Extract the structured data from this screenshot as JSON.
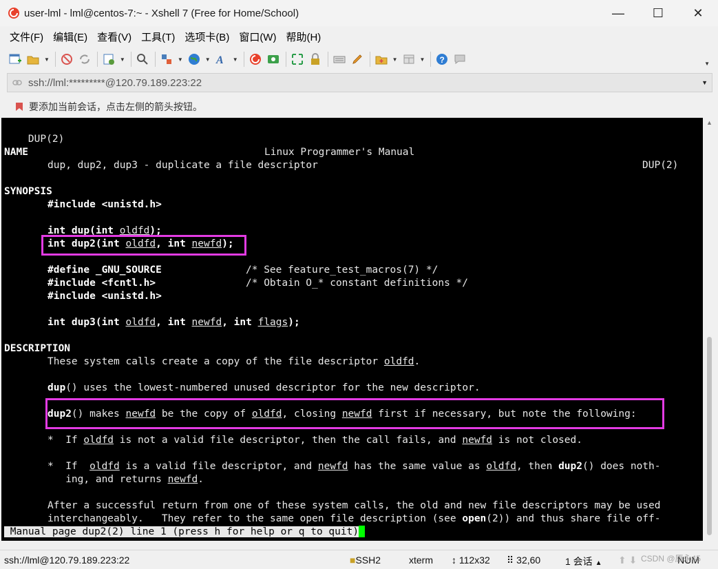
{
  "window": {
    "title": "user-lml - lml@centos-7:~ - Xshell 7 (Free for Home/School)",
    "minimize": "—",
    "maximize": "☐",
    "close": "✕"
  },
  "menu": [
    "文件(F)",
    "编辑(E)",
    "查看(V)",
    "工具(T)",
    "选项卡(B)",
    "窗口(W)",
    "帮助(H)"
  ],
  "address": {
    "value": "ssh://lml:*********@120.79.189.223:22"
  },
  "hint": {
    "text": "要添加当前会话，点击左侧的箭头按钮。"
  },
  "terminal": {
    "header_left": "DUP(2)",
    "header_center": "Linux Programmer's Manual",
    "header_right": "DUP(2)",
    "name_heading": "NAME",
    "name_desc": "dup, dup2, dup3 - duplicate a file descriptor",
    "synopsis_heading": "SYNOPSIS",
    "include_unistd": "#include <unistd.h>",
    "dup_sig": {
      "pre": "int dup(int ",
      "arg": "oldfd",
      "post": ");"
    },
    "dup2_sig": {
      "pre": "int dup2(int ",
      "arg1": "oldfd",
      "mid": ", int ",
      "arg2": "newfd",
      "post": ");"
    },
    "define_gnu": "#define _GNU_SOURCE",
    "define_gnu_comment": "/* See feature_test_macros(7) */",
    "include_fcntl": "#include <fcntl.h>",
    "include_fcntl_comment": "/* Obtain O_* constant definitions */",
    "include_unistd2": "#include <unistd.h>",
    "dup3_sig": {
      "pre": "int dup3(int ",
      "arg1": "oldfd",
      "mid1": ", int ",
      "arg2": "newfd",
      "mid2": ", int ",
      "arg3": "flags",
      "post": ");"
    },
    "description_heading": "DESCRIPTION",
    "desc1": {
      "pre": "These system calls create a copy of the file descriptor ",
      "arg": "oldfd",
      "post": "."
    },
    "desc2": {
      "bold": "dup",
      "post": "() uses the lowest-numbered unused descriptor for the new descriptor."
    },
    "desc3": {
      "bold": "dup2",
      "a": "() makes ",
      "u1": "newfd",
      "b": " be the copy of ",
      "u2": "oldfd",
      "c": ", closing ",
      "u3": "newfd",
      "d": " first if necessary, but note the following:"
    },
    "bullet1": {
      "a": "*  If ",
      "u1": "oldfd",
      "b": " is not a valid file descriptor, then the call fails, and ",
      "u2": "newfd",
      "c": " is not closed."
    },
    "bullet2": {
      "a": "*  If  ",
      "u1": "oldfd",
      "b": " is a valid file descriptor, and ",
      "u2": "newfd",
      "c": " has the same value as ",
      "u3": "oldfd",
      "d": ", then ",
      "bold": "dup2",
      "e": "() does noth-"
    },
    "bullet2b": {
      "a": "   ing, and returns ",
      "u1": "newfd",
      "b": "."
    },
    "after1": "After a successful return from one of these system calls, the old and new file descriptors may be used",
    "after2": {
      "a": "interchangeably.   They refer to the same open file description (see ",
      "bold": "open",
      "b": "(2)) and thus share file off-"
    },
    "status_line": " Manual page dup2(2) line 1 (press h for help or q to quit)"
  },
  "statusbar": {
    "connection": "ssh://lml@120.79.189.223:22",
    "protocol": "SSH2",
    "term": "xterm",
    "size": "112x32",
    "cursor_pos": "32,60",
    "sessions": "1 会话",
    "num": "NUM",
    "watermark": "CSDN @原永45"
  },
  "colors": {
    "highlight": "#e33be3",
    "cursor": "#00ff00",
    "terminal_bg": "#000000"
  }
}
